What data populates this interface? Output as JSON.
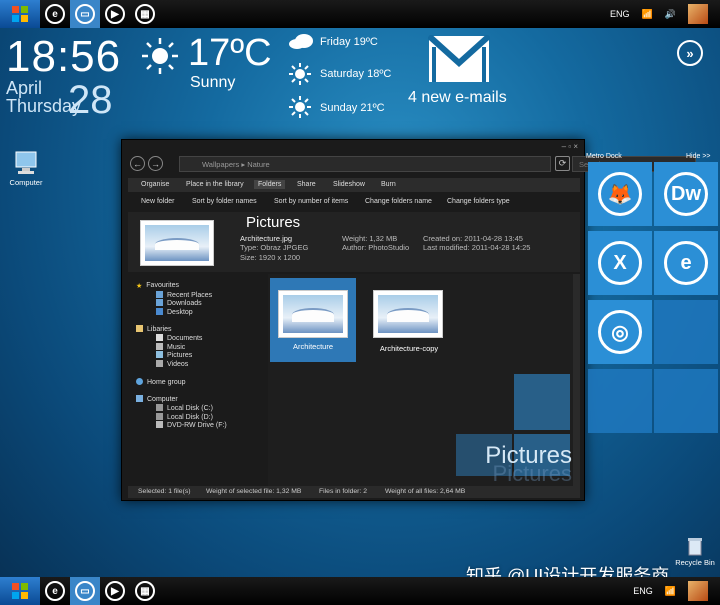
{
  "taskbar": {
    "lang": "ENG",
    "icons": [
      "start-icon",
      "ie-icon",
      "folder-icon",
      "play-icon",
      "apps-icon"
    ]
  },
  "clock": {
    "time": "18:56",
    "month": "April",
    "weekday": "Thursday",
    "day": "28"
  },
  "weather": {
    "temp": "17ºC",
    "condition": "Sunny",
    "forecast": [
      {
        "day": "Friday 19ºC",
        "icon": "cloud-icon"
      },
      {
        "day": "Saturday 18ºC",
        "icon": "sun-icon"
      },
      {
        "day": "Sunday 21ºC",
        "icon": "sun-icon"
      }
    ]
  },
  "mail": {
    "count_text": "4 new e-mails"
  },
  "explorer": {
    "breadcrumb": [
      "Wallpapers",
      "Nature"
    ],
    "search_placeholder": "Search...",
    "menu": [
      "Organise",
      "Place in the library",
      "Folders",
      "Share",
      "Slideshow",
      "Burn"
    ],
    "toolbar": [
      "New folder",
      "Sort by folder names",
      "Sort by number of items",
      "Change folders name",
      "Change folders type"
    ],
    "preview": {
      "title": "Pictures",
      "file": "Architecture.jpg",
      "type": "Type: Obraz JPGEG",
      "size": "Size: 1920 x 1200",
      "weight": "Weight: 1,32 MB",
      "author": "Author: PhotoStudio",
      "created": "Created on: 2011-04-28 13:45",
      "modified": "Last modified: 2011-04-28 14:25"
    },
    "nav": {
      "favourites": "Favourites",
      "fav_items": [
        "Recent Places",
        "Downloads",
        "Desktop"
      ],
      "libraries": "Libaries",
      "lib_items": [
        "Documents",
        "Music",
        "Pictures",
        "Videos"
      ],
      "homegroup": "Home group",
      "computer": "Computer",
      "drives": [
        "Local Disk (C:)",
        "Local Disk (D:)",
        "DVD-RW Drive (F:)"
      ]
    },
    "files": [
      "Architecture",
      "Architecture-copy"
    ],
    "watermark": "Pictures",
    "status": {
      "selected": "Selected: 1 file(s)",
      "weight_selected": "Weight of selected file: 1,32 MB",
      "files_in_folder": "Files in folder: 2",
      "weight_all": "Weight of all files: 2,64 MB"
    }
  },
  "dock": {
    "title": "Metro Dock",
    "hide": "Hide >>",
    "tiles": [
      "firefox-icon",
      "dreamweaver-icon",
      "excel-icon",
      "ie-icon",
      "chrome-icon",
      "empty",
      "empty",
      "empty"
    ],
    "dw_label": "Dw"
  },
  "desktop": {
    "computer_label": "Computer",
    "recycle_label": "Recycle Bin"
  },
  "watermark_text": "知乎 @UI设计开发服务商"
}
